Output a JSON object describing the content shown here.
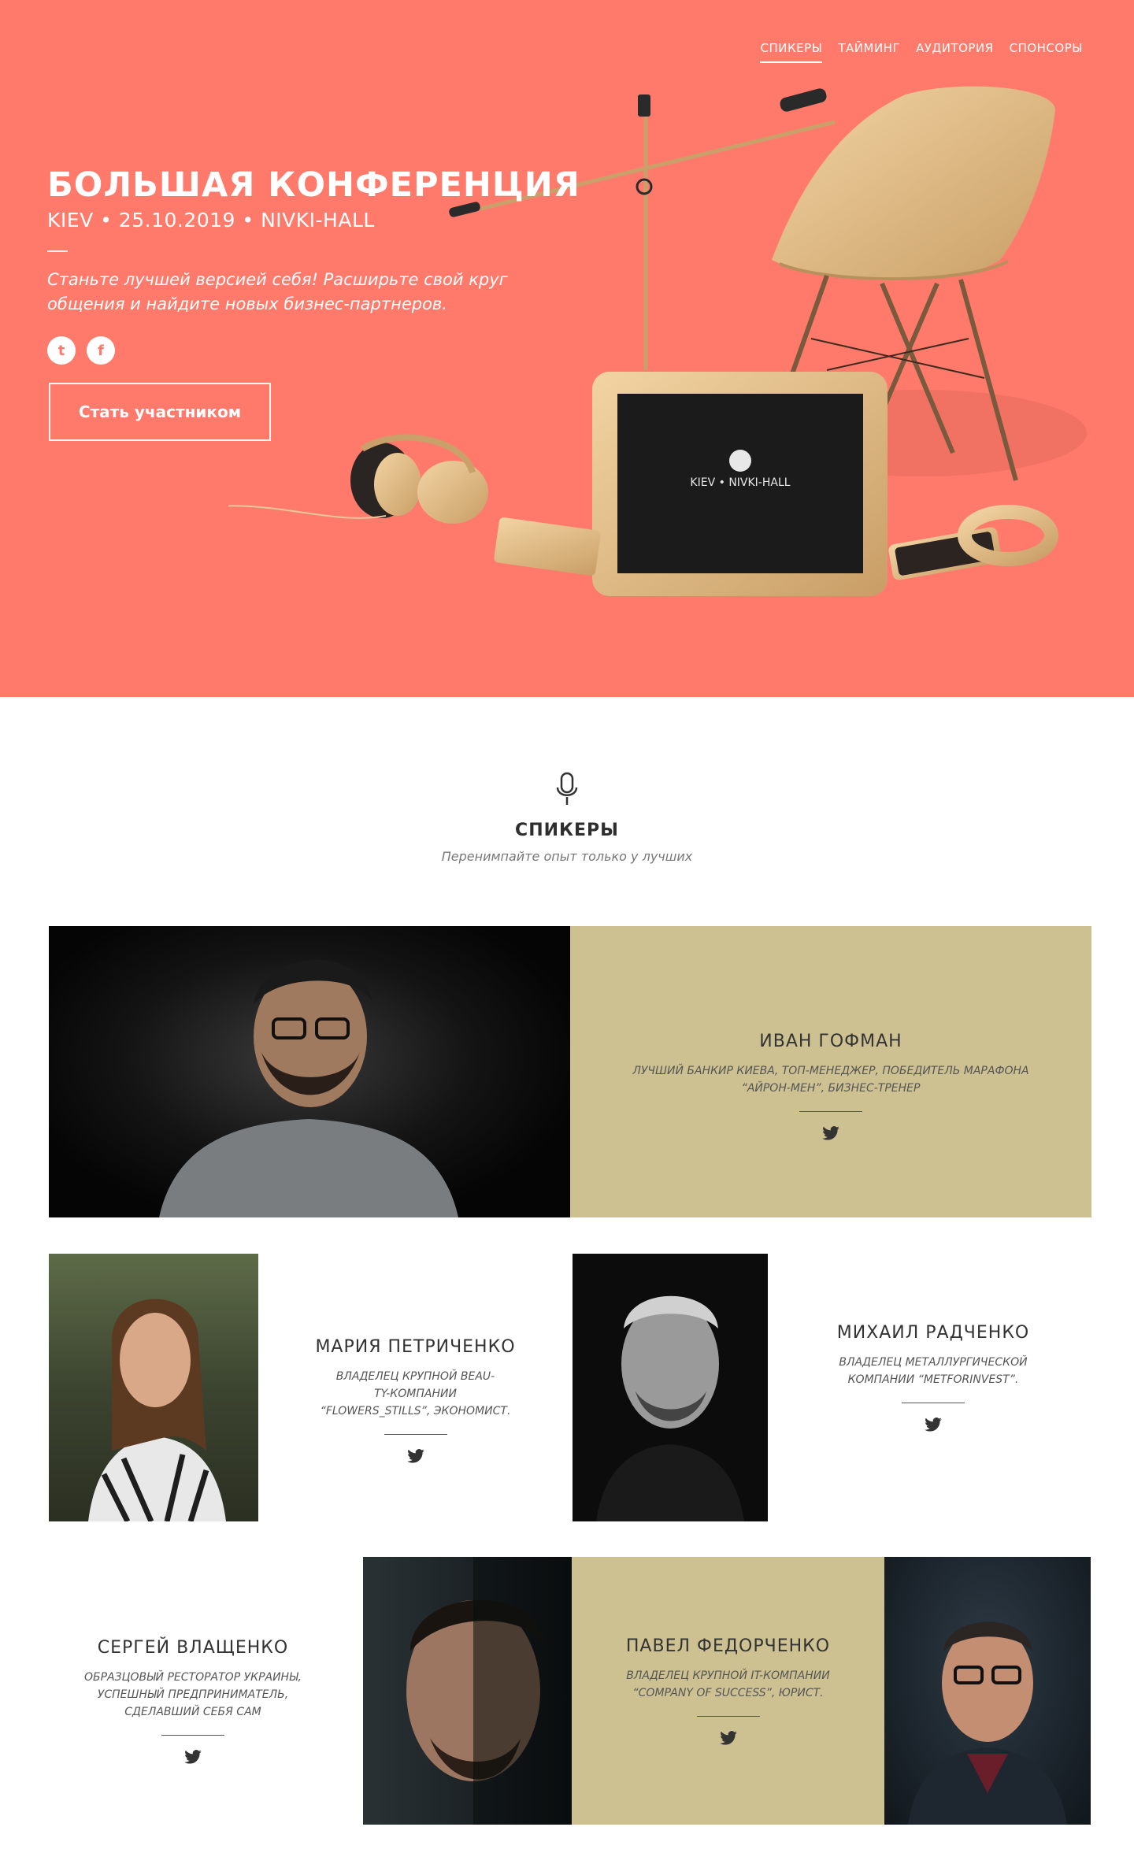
{
  "nav": {
    "items": [
      "СПИКЕРЫ",
      "ТАЙМИНГ",
      "АУДИТОРИЯ",
      "СПОНСОРЫ"
    ],
    "active": 0
  },
  "hero": {
    "title": "БОЛЬШАЯ КОНФЕРЕНЦИЯ",
    "subtitle": "KIEV • 25.10.2019 • NIVKI-HALL",
    "description": "Станьте лучшей версией себя! Расширьте свой круг общения и  найдите новых бизнес-партнеров.",
    "socials": [
      {
        "icon": "twitter-icon",
        "glyph": "t"
      },
      {
        "icon": "facebook-icon",
        "glyph": "f"
      }
    ],
    "cta_label": "Стать участником",
    "tablet_text": "KIEV • NIVKI-HALL",
    "colors": {
      "background": "#ff7a6b",
      "gold": "#d9b27c"
    }
  },
  "speakers_section": {
    "icon": "microphone-icon",
    "title": "СПИКЕРЫ",
    "subtitle": "Перенимпайте опыт только у лучших"
  },
  "speakers": [
    {
      "name": "ИВАН ГОФМАН",
      "description": "ЛУЧШИЙ БАНКИР КИЕВА, ТОП-МЕНЕДЖЕР, ПОБЕДИТЕЛЬ МАРАФОНА “АЙРОН-МЕН”,  БИЗНЕС-ТРЕНЕР",
      "social_icon": "twitter-icon"
    },
    {
      "name": "МАРИЯ ПЕТРИЧЕНКО",
      "description": "ВЛАДЕЛЕЦ КРУПНОЙ BEAU-\nTY-КОМПАНИИ\n“FLOWERS_STILLS”, ЭКОНОМИСТ.",
      "social_icon": "twitter-icon"
    },
    {
      "name": "МИХАИЛ РАДЧЕНКО",
      "description": "ВЛАДЕЛЕЦ МЕТАЛЛУРГИЧЕСКОЙ КОМПАНИИ “METFORINVEST”.",
      "social_icon": "twitter-icon"
    },
    {
      "name": "СЕРГЕЙ ВЛАЩЕНКО",
      "description": "ОБРАЗЦОВЫЙ РЕСТОРАТОР УКРАИНЫ, УСПЕШНЫЙ ПРЕДПРИНИМАТЕЛЬ, СДЕЛАВШИЙ СЕБЯ САМ",
      "social_icon": "twitter-icon"
    },
    {
      "name": "ПАВЕЛ ФЕДОРЧЕНКО",
      "description": "ВЛАДЕЛЕЦ КРУПНОЙ IT-КОМПАНИИ “COMPANY OF SUCCESS”, ЮРИСТ.",
      "social_icon": "twitter-icon"
    }
  ],
  "colors": {
    "accent_beige": "#cdc192",
    "text_dark": "#333333"
  }
}
